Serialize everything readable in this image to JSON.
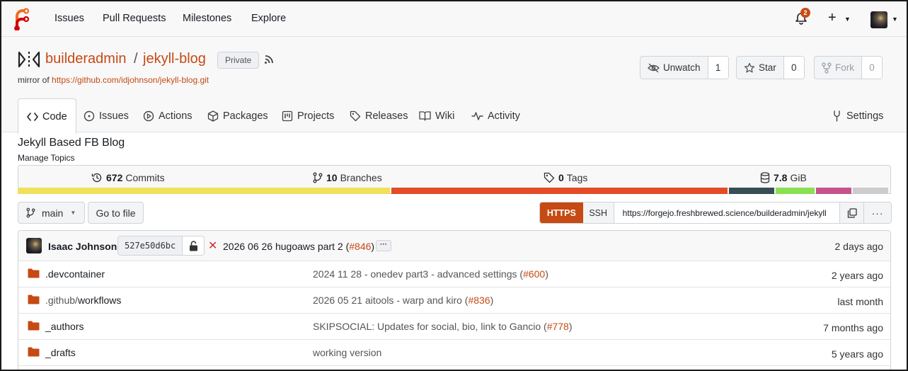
{
  "nav": {
    "items": [
      "Issues",
      "Pull Requests",
      "Milestones",
      "Explore"
    ],
    "notification_count": "2",
    "plus": "+"
  },
  "repo": {
    "owner": "builderadmin",
    "separator": "/",
    "name": "jekyll-blog",
    "visibility": "Private",
    "mirror_prefix": "mirror of",
    "mirror_url": "https://github.com/idjohnson/jekyll-blog.git"
  },
  "actions": {
    "unwatch_label": "Unwatch",
    "unwatch_count": "1",
    "star_label": "Star",
    "star_count": "0",
    "fork_label": "Fork",
    "fork_count": "0"
  },
  "tabs": [
    {
      "label": "Code"
    },
    {
      "label": "Issues"
    },
    {
      "label": "Actions"
    },
    {
      "label": "Packages"
    },
    {
      "label": "Projects"
    },
    {
      "label": "Releases"
    },
    {
      "label": "Wiki"
    },
    {
      "label": "Activity"
    },
    {
      "label": "Settings"
    }
  ],
  "description": "Jekyll Based FB Blog",
  "manage_topics": "Manage Topics",
  "stats": {
    "commits_count": "672",
    "commits_label": "Commits",
    "branches_count": "10",
    "branches_label": "Branches",
    "tags_count": "0",
    "tags_label": "Tags",
    "size_value": "7.8",
    "size_unit": "GiB"
  },
  "language_bar": [
    {
      "color": "#f1e05a",
      "share": 0.43
    },
    {
      "color": "#e34c26",
      "share": 0.388
    },
    {
      "color": "#384d54",
      "share": 0.052
    },
    {
      "color": "#89e051",
      "share": 0.045
    },
    {
      "color": "#c6538c",
      "share": 0.041
    },
    {
      "color": "#cccccc",
      "share": 0.041
    }
  ],
  "branch": {
    "current": "main",
    "go_to_file": "Go to file"
  },
  "clone": {
    "https_label": "HTTPS",
    "ssh_label": "SSH",
    "url": "https://forgejo.freshbrewed.science/builderadmin/jekyll",
    "more": "···"
  },
  "latest_commit": {
    "author": "Isaac Johnson",
    "sha": "527e50d6bc",
    "status": "✕",
    "message": "2026 06 26 hugoaws part 2 (",
    "pr": "#846",
    "message_end": ")",
    "ellipsis": "···",
    "time": "2 days ago"
  },
  "files": [
    {
      "name": ".devcontainer",
      "msg": "2024 11 28 - onedev part3 - advanced settings (",
      "pr": "#600",
      "msg_end": ")",
      "time": "2 years ago"
    },
    {
      "name_pre": ".github/",
      "name": "workflows",
      "msg": "2026 05 21 aitools - warp and kiro (",
      "pr": "#836",
      "msg_end": ")",
      "time": "last month"
    },
    {
      "name": "_authors",
      "msg": "SKIPSOCIAL: Updates for social, bio, link to Gancio (",
      "pr": "#778",
      "msg_end": ")",
      "time": "7 months ago"
    },
    {
      "name": "_drafts",
      "msg": "working version",
      "pr": "",
      "msg_end": "",
      "time": "5 years ago"
    }
  ],
  "colors": {
    "accent": "#c64a13",
    "fail": "#d02b2b"
  }
}
